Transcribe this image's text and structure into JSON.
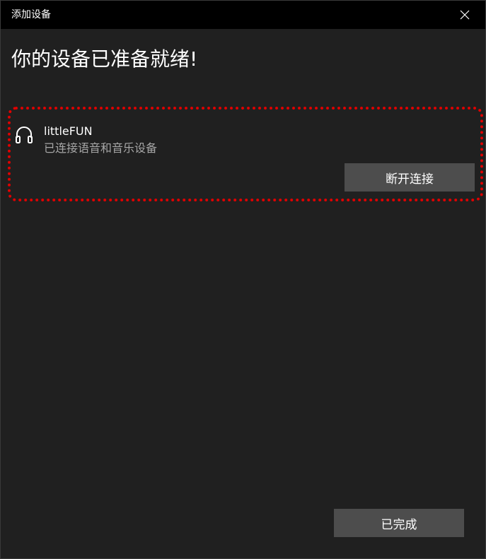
{
  "window": {
    "title": "添加设备",
    "close_icon": "close-icon"
  },
  "heading": "你的设备已准备就绪!",
  "device": {
    "icon": "headphones-icon",
    "name": "littleFUN",
    "status": "已连接语音和音乐设备",
    "disconnect_label": "断开连接"
  },
  "footer": {
    "done_label": "已完成"
  },
  "colors": {
    "background": "#202020",
    "titlebar": "#000000",
    "button": "#4d4d4d",
    "secondary_text": "#a6a6a6",
    "highlight_border": "#e00000"
  }
}
